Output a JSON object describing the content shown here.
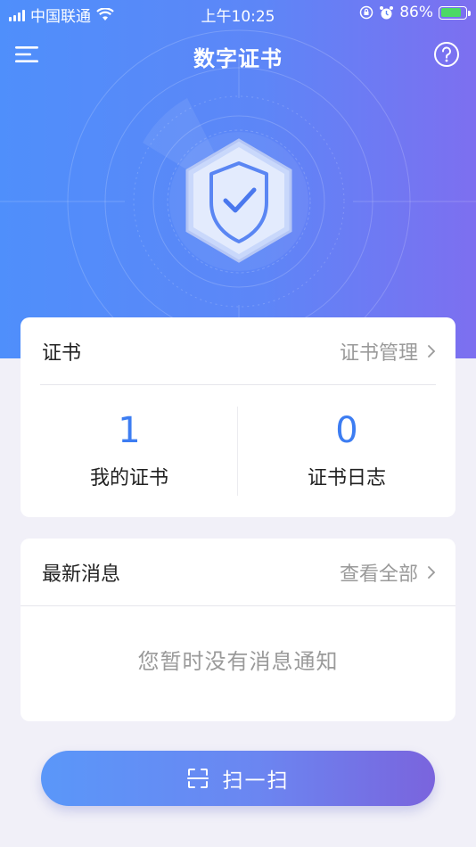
{
  "status_bar": {
    "carrier": "中国联通",
    "time": "上午10:25",
    "battery_percent": "86%",
    "battery_level": 0.86
  },
  "nav": {
    "title": "数字证书",
    "menu_icon": "menu-icon",
    "help_icon": "help-icon"
  },
  "hero": {
    "shield_icon": "shield-check-icon"
  },
  "cert_card": {
    "title": "证书",
    "link_label": "证书管理",
    "stats": [
      {
        "value": "1",
        "label": "我的证书"
      },
      {
        "value": "0",
        "label": "证书日志"
      }
    ]
  },
  "message_card": {
    "title": "最新消息",
    "link_label": "查看全部",
    "empty_text": "您暂时没有消息通知"
  },
  "scan_button": {
    "label": "扫一扫",
    "icon": "scan-icon"
  },
  "colors": {
    "accent": "#3d7df2",
    "gradient_start": "#4f8ffb",
    "gradient_end": "#7d6ff0",
    "battery_fill": "#4cd964"
  }
}
